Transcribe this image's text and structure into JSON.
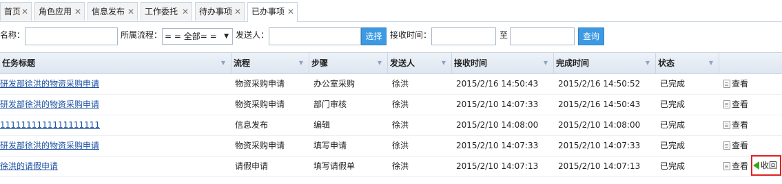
{
  "tabs": [
    {
      "label": "首页",
      "close": "✕"
    },
    {
      "label": "角色应用",
      "close": "✕"
    },
    {
      "label": "信息发布",
      "close": "✕"
    },
    {
      "label": "工作委托",
      "close": "✕"
    },
    {
      "label": "待办事项",
      "close": "✕"
    },
    {
      "label": "已办事项",
      "close": "✕"
    }
  ],
  "search": {
    "name_label": "名称：",
    "name_value": "",
    "process_label": "所属流程：",
    "process_value": "= = 全部= =",
    "sender_label": "发送人：",
    "sender_value": "",
    "select_button": "选择",
    "receive_label": "接收时间：",
    "receive_from": "",
    "to_label": "至",
    "receive_to": "",
    "query_button": "查询"
  },
  "table": {
    "columns": [
      "任务标题",
      "流程",
      "步骤",
      "发送人",
      "接收时间",
      "完成时间",
      "状态"
    ],
    "view_label": "查看",
    "recall_label": "收回",
    "rows": [
      {
        "title": "研发部徐洪的物资采购申请",
        "process": "物资采购申请",
        "step": "办公室采购",
        "sender": "徐洪",
        "received": "2015/2/16 14:50:43",
        "completed": "2015/2/16 14:50:52",
        "status": "已完成"
      },
      {
        "title": "研发部徐洪的物资采购申请",
        "process": "物资采购申请",
        "step": "部门审核",
        "sender": "徐洪",
        "received": "2015/2/10 14:07:33",
        "completed": "2015/2/16 14:50:43",
        "status": "已完成"
      },
      {
        "title": "1111111111111111111",
        "process": "信息发布",
        "step": "编辑",
        "sender": "徐洪",
        "received": "2015/2/10 14:08:00",
        "completed": "2015/2/10 14:08:00",
        "status": "已完成"
      },
      {
        "title": "研发部徐洪的物资采购申请",
        "process": "物资采购申请",
        "step": "填写申请",
        "sender": "徐洪",
        "received": "2015/2/10 14:07:33",
        "completed": "2015/2/10 14:07:33",
        "status": "已完成"
      },
      {
        "title": "徐洪的请假申请",
        "process": "请假申请",
        "step": "填写请假单",
        "sender": "徐洪",
        "received": "2015/2/10 14:07:13",
        "completed": "2015/2/10 14:07:13",
        "status": "已完成"
      }
    ]
  },
  "colors": {
    "accent": "#3d9ae2",
    "link": "#1a4fa3",
    "header_bg": "#dde6f1",
    "highlight_border": "#e02020",
    "recall_arrow": "#3aa41c"
  }
}
